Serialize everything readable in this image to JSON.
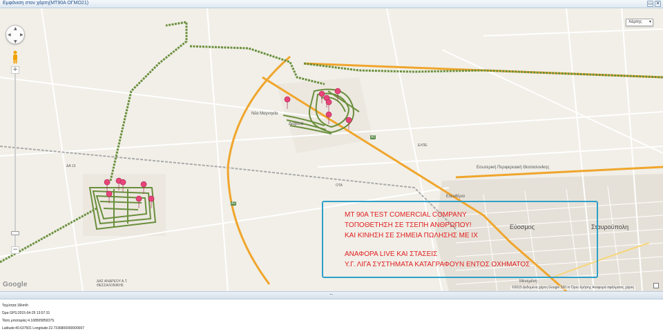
{
  "window": {
    "title": "Εμφάνιση στον χάρτη(ΜΤ90Α  ΟΓΜΟ21)",
    "buttons": [
      "▭",
      "✕"
    ]
  },
  "map": {
    "maptype_label": "Χάρτης",
    "google_logo": "Google",
    "attribution": "©2015 Δεδομένα χάρτη Google  500 m  Όροι Χρήσης  Αναφορά σφάλματος χάρτη",
    "labels": {
      "nea_magnisia": "Νέα Μαγνησία",
      "diavata": "Διαβατά",
      "efkarpia_ring": "Εσωτερική Περιφερειακή Θεσσαλονίκης",
      "eleftherio": "Ελευθέριο",
      "evosmos": "Εύοσμος",
      "stavroupoli": "Σταυρούπολη",
      "menemeni": "Μενεμένη",
      "dasos": "ΔΑΣ ΑΝΔΡΕΟΥ Α.Τ. ΘΕΣΣΑΛΟΝΙΚΗΣ",
      "da13": "ΔΑ 13",
      "elpe": "ΕΛΠΕ",
      "ota": "ΟΤΑ",
      "route_a1": "A1",
      "route_a25": "A2"
    }
  },
  "annotation": {
    "lines": [
      "MT 90A TEST COMERCIAL COMPANY",
      "ΤΟΠΟΘΕΤΗΣΗ ΣΕ ΤΣΕΠΗ ΑΝΘΡΩΠΟΥ!",
      "ΚΑΙ ΚΙΝΗΣΗ ΣΕ ΣΗΜΕΙΑ ΠΩΛΗΣΗΣ ΜΕ ΙΧ",
      "ΑΝΑΦΟΡΑ LIVE ΚΑΙ ΣΤΑΣΕΙΣ",
      "Υ.Γ. ΛΙΓΑ ΣΥΣΤΗΜΑΤΑ ΚΑΤΑΓΡΑΦΟΥΝ ΕΝΤΟΣ ΟΧΗΜΑΤΟΣ"
    ],
    "color": "#e02020",
    "border": "#2ca0c8"
  },
  "info": {
    "speed": "Ταχύτητα:16km/h",
    "gps_time": "Ώρα GPS:2015-04-25 13:57:31",
    "voltage": "Τάση μπαταρίας:4.16850585937S",
    "coords": "Latitude:40.637501 Longitude:22.7336800000000007"
  },
  "colors": {
    "track": "#6a8f3c",
    "marker": "#e8457a",
    "highway": "#f0a52b",
    "railway": "#a9a9a9"
  }
}
